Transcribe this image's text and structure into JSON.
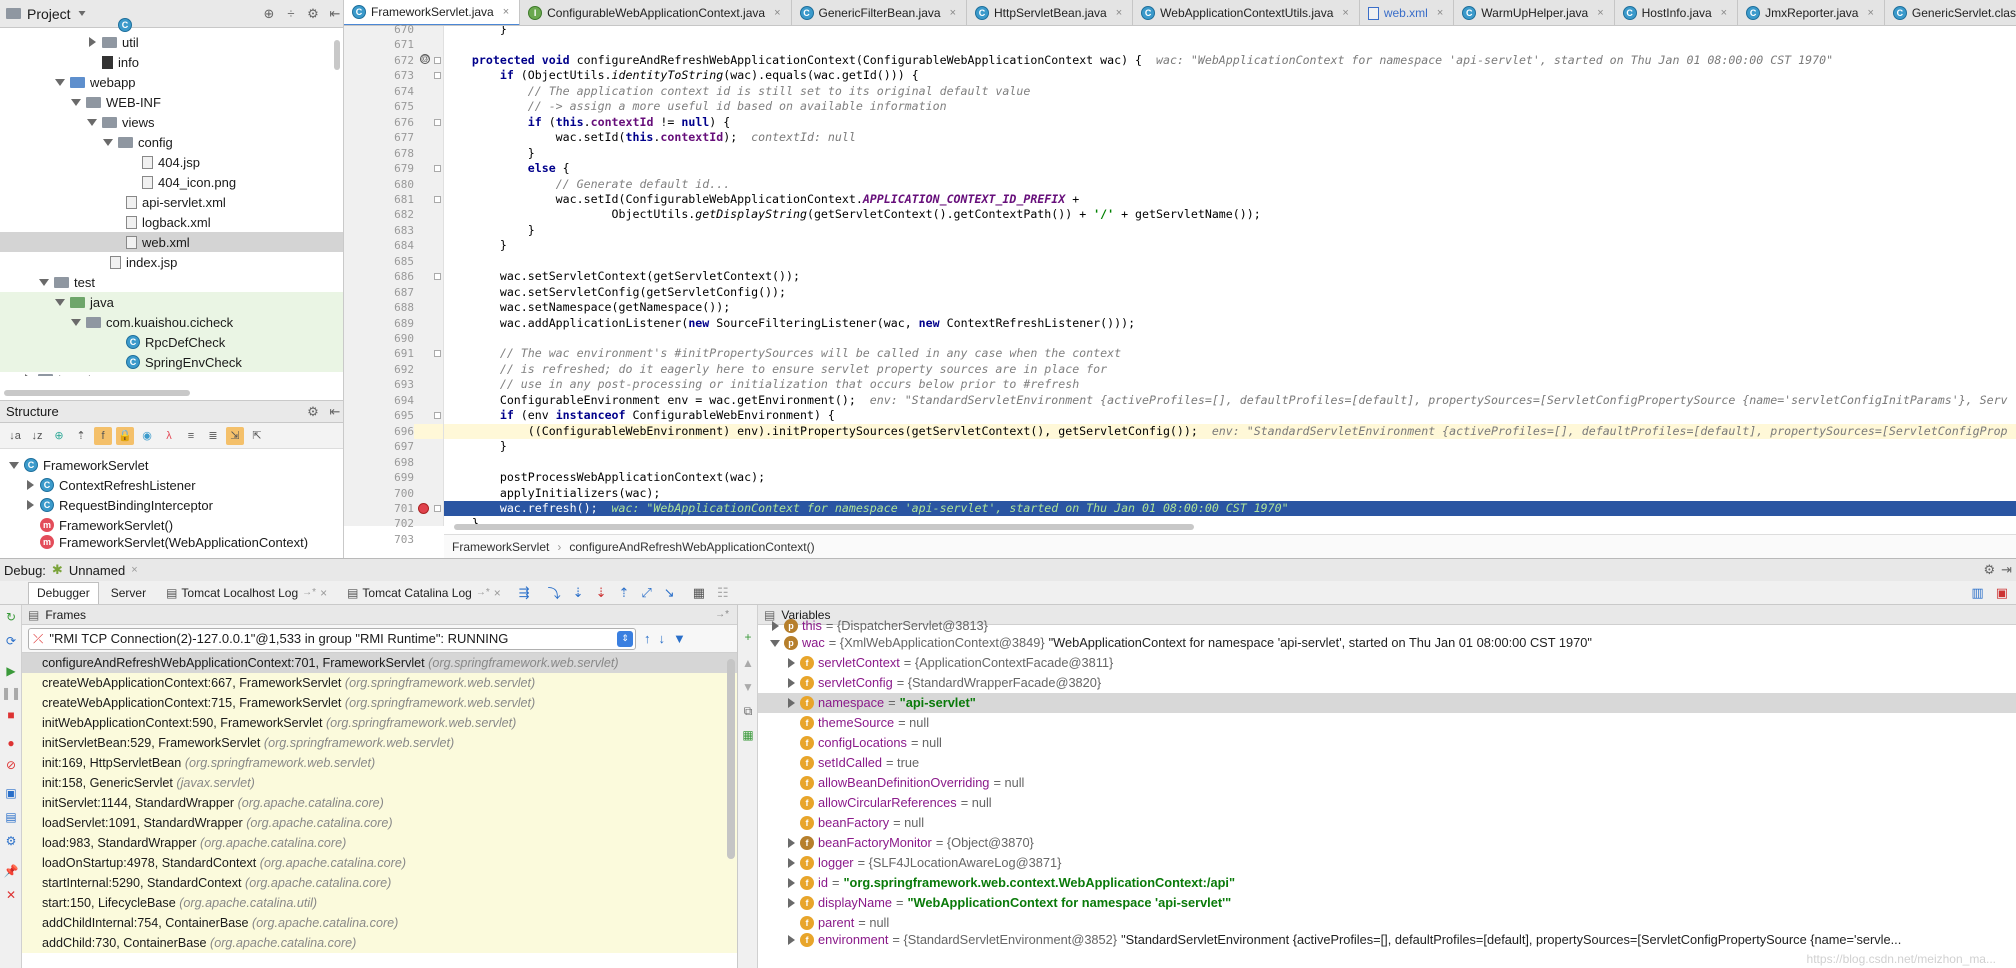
{
  "project": {
    "title": "Project",
    "tree": [
      {
        "label": "",
        "indent": 98,
        "icon": "class",
        "arrow": "none",
        "cut": true
      },
      {
        "label": "util",
        "indent": 82,
        "icon": "folder",
        "arrow": "right"
      },
      {
        "label": "info",
        "indent": 82,
        "icon": "filedark",
        "arrow": "none"
      },
      {
        "label": "webapp",
        "indent": 50,
        "icon": "folder-blue",
        "arrow": "down"
      },
      {
        "label": "WEB-INF",
        "indent": 66,
        "icon": "folder",
        "arrow": "down"
      },
      {
        "label": "views",
        "indent": 82,
        "icon": "folder",
        "arrow": "down"
      },
      {
        "label": "config",
        "indent": 98,
        "icon": "folder",
        "arrow": "down"
      },
      {
        "label": "404.jsp",
        "indent": 122,
        "icon": "file",
        "arrow": "none"
      },
      {
        "label": "404_icon.png",
        "indent": 122,
        "icon": "file",
        "arrow": "none"
      },
      {
        "label": "api-servlet.xml",
        "indent": 106,
        "icon": "file",
        "arrow": "none"
      },
      {
        "label": "logback.xml",
        "indent": 106,
        "icon": "file",
        "arrow": "none"
      },
      {
        "label": "web.xml",
        "indent": 106,
        "icon": "file",
        "arrow": "none",
        "selected": true
      },
      {
        "label": "index.jsp",
        "indent": 90,
        "icon": "file",
        "arrow": "none"
      },
      {
        "label": "test",
        "indent": 34,
        "icon": "folder",
        "arrow": "down"
      },
      {
        "label": "java",
        "indent": 50,
        "icon": "folder-green",
        "arrow": "down",
        "green": true
      },
      {
        "label": "com.kuaishou.cicheck",
        "indent": 66,
        "icon": "folder",
        "arrow": "down",
        "green": true
      },
      {
        "label": "RpcDefCheck",
        "indent": 106,
        "icon": "class",
        "arrow": "none",
        "green": true
      },
      {
        "label": "SpringEnvCheck",
        "indent": 106,
        "icon": "class",
        "arrow": "none",
        "green": true
      },
      {
        "label": "target",
        "indent": 18,
        "icon": "folder",
        "arrow": "right",
        "cut": true
      }
    ]
  },
  "structure": {
    "title": "Structure",
    "tree": [
      {
        "label": "FrameworkServlet",
        "indent": 4,
        "icon": "class",
        "arrow": "down"
      },
      {
        "label": "ContextRefreshListener",
        "indent": 20,
        "icon": "class",
        "arrow": "right"
      },
      {
        "label": "RequestBindingInterceptor",
        "indent": 20,
        "icon": "class",
        "arrow": "right"
      },
      {
        "label": "FrameworkServlet()",
        "indent": 20,
        "icon": "method",
        "arrow": "none"
      },
      {
        "label": "FrameworkServlet(WebApplicationContext)",
        "indent": 20,
        "icon": "method",
        "arrow": "none",
        "cut": true
      }
    ]
  },
  "editor": {
    "tabs": [
      {
        "label": "FrameworkServlet.java",
        "icon": "class",
        "active": true
      },
      {
        "label": "ConfigurableWebApplicationContext.java",
        "icon": "interface"
      },
      {
        "label": "GenericFilterBean.java",
        "icon": "class"
      },
      {
        "label": "HttpServletBean.java",
        "icon": "class"
      },
      {
        "label": "WebApplicationContextUtils.java",
        "icon": "class"
      },
      {
        "label": "web.xml",
        "icon": "xml",
        "blue": true
      },
      {
        "label": "WarmUpHelper.java",
        "icon": "class"
      },
      {
        "label": "HostInfo.java",
        "icon": "class"
      },
      {
        "label": "JmxReporter.java",
        "icon": "class"
      },
      {
        "label": "GenericServlet.class",
        "icon": "class"
      }
    ],
    "lines": [
      {
        "n": "670",
        "h": "        }"
      },
      {
        "n": "671",
        "h": ""
      },
      {
        "n": "672",
        "h": "    <span class=\"kw\">protected void</span> configureAndRefreshWebApplicationContext(ConfigurableWebApplicationContext wac) {  <span class=\"hint\">wac: \"WebApplicationContext for namespace 'api-servlet', started on Thu Jan 01 08:00:00 CST 1970\"</span>"
      },
      {
        "n": "673",
        "h": "        <span class=\"kw\">if</span> (ObjectUtils.<span class=\"it\">identityToString</span>(wac).equals(wac.getId())) {"
      },
      {
        "n": "674",
        "h": "            <span class=\"cm\">// The application context id is still set to its original default value</span>"
      },
      {
        "n": "675",
        "h": "            <span class=\"cm\">// -&gt; assign a more useful id based on available information</span>"
      },
      {
        "n": "676",
        "h": "            <span class=\"kw\">if</span> (<span class=\"kw\">this</span>.<span class=\"fd\">contextId</span> != <span class=\"kw\">null</span>) {"
      },
      {
        "n": "677",
        "h": "                wac.setId(<span class=\"kw\">this</span>.<span class=\"fd\">contextId</span>);  <span class=\"hint\">contextId: null</span>"
      },
      {
        "n": "678",
        "h": "            }"
      },
      {
        "n": "679",
        "h": "            <span class=\"kw\">else</span> {"
      },
      {
        "n": "680",
        "h": "                <span class=\"cm\">// Generate default id...</span>"
      },
      {
        "n": "681",
        "h": "                wac.setId(ConfigurableWebApplicationContext.<span class=\"cn\">APPLICATION_CONTEXT_ID_PREFIX</span> +"
      },
      {
        "n": "682",
        "h": "                        ObjectUtils.<span class=\"it\">getDisplayString</span>(getServletContext().getContextPath()) + <span class=\"st\">'/'</span> + getServletName());"
      },
      {
        "n": "683",
        "h": "            }"
      },
      {
        "n": "684",
        "h": "        }"
      },
      {
        "n": "685",
        "h": ""
      },
      {
        "n": "686",
        "h": "        wac.setServletContext(getServletContext());"
      },
      {
        "n": "687",
        "h": "        wac.setServletConfig(getServletConfig());"
      },
      {
        "n": "688",
        "h": "        wac.setNamespace(getNamespace());"
      },
      {
        "n": "689",
        "h": "        wac.addApplicationListener(<span class=\"kw\">new</span> SourceFilteringListener(wac, <span class=\"kw\">new</span> ContextRefreshListener()));"
      },
      {
        "n": "690",
        "h": ""
      },
      {
        "n": "691",
        "h": "        <span class=\"cm\">// The wac environment's #initPropertySources will be called in any case when the context</span>"
      },
      {
        "n": "692",
        "h": "        <span class=\"cm\">// is refreshed; do it eagerly here to ensure servlet property sources are in place for</span>"
      },
      {
        "n": "693",
        "h": "        <span class=\"cm\">// use in any post-processing or initialization that occurs below prior to #refresh</span>"
      },
      {
        "n": "694",
        "h": "        ConfigurableEnvironment env = wac.getEnvironment();  <span class=\"hint\">env: \"StandardServletEnvironment {activeProfiles=[], defaultProfiles=[default], propertySources=[ServletConfigPropertySource {name='servletConfigInitParams'}, Serv</span>"
      },
      {
        "n": "695",
        "h": "        <span class=\"kw\">if</span> (env <span class=\"kw\">instanceof</span> ConfigurableWebEnvironment) {"
      },
      {
        "n": "696",
        "h": "            ((ConfigurableWebEnvironment) env).initPropertySources(getServletContext(), getServletConfig());  <span class=\"hint\">env: \"StandardServletEnvironment {activeProfiles=[], defaultProfiles=[default], propertySources=[ServletConfigProp</span>",
        "cur": true
      },
      {
        "n": "697",
        "h": "        }"
      },
      {
        "n": "698",
        "h": ""
      },
      {
        "n": "699",
        "h": "        postProcessWebApplicationContext(wac);"
      },
      {
        "n": "700",
        "h": "        applyInitializers(wac);"
      },
      {
        "n": "701",
        "h": "        wac.refresh();  <span class=\"hint\">wac: \"WebApplicationContext for namespace 'api-servlet', started on Thu Jan 01 08:00:00 CST 1970\"</span>",
        "hl": true
      },
      {
        "n": "702",
        "h": "    }"
      },
      {
        "n": "703",
        "h": ""
      }
    ],
    "breadcrumb": [
      "FrameworkServlet",
      "configureAndRefreshWebApplicationContext()"
    ]
  },
  "debug": {
    "label": "Debug:",
    "session": "Unnamed",
    "tabs": [
      "Debugger",
      "Server",
      "Tomcat Localhost Log",
      "Tomcat Catalina Log"
    ],
    "frames_title": "Frames",
    "variables_title": "Variables",
    "thread": "\"RMI TCP Connection(2)-127.0.0.1\"@1,533 in group \"RMI Runtime\": RUNNING",
    "frames": [
      {
        "m": "configureAndRefreshWebApplicationContext:701, FrameworkServlet",
        "p": "(org.springframework.web.servlet)",
        "sel": true
      },
      {
        "m": "createWebApplicationContext:667, FrameworkServlet",
        "p": "(org.springframework.web.servlet)"
      },
      {
        "m": "createWebApplicationContext:715, FrameworkServlet",
        "p": "(org.springframework.web.servlet)"
      },
      {
        "m": "initWebApplicationContext:590, FrameworkServlet",
        "p": "(org.springframework.web.servlet)"
      },
      {
        "m": "initServletBean:529, FrameworkServlet",
        "p": "(org.springframework.web.servlet)"
      },
      {
        "m": "init:169, HttpServletBean",
        "p": "(org.springframework.web.servlet)"
      },
      {
        "m": "init:158, GenericServlet",
        "p": "(javax.servlet)"
      },
      {
        "m": "initServlet:1144, StandardWrapper",
        "p": "(org.apache.catalina.core)"
      },
      {
        "m": "loadServlet:1091, StandardWrapper",
        "p": "(org.apache.catalina.core)"
      },
      {
        "m": "load:983, StandardWrapper",
        "p": "(org.apache.catalina.core)"
      },
      {
        "m": "loadOnStartup:4978, StandardContext",
        "p": "(org.apache.catalina.core)"
      },
      {
        "m": "startInternal:5290, StandardContext",
        "p": "(org.apache.catalina.core)"
      },
      {
        "m": "start:150, LifecycleBase",
        "p": "(org.apache.catalina.util)"
      },
      {
        "m": "addChildInternal:754, ContainerBase",
        "p": "(org.apache.catalina.core)"
      },
      {
        "m": "addChild:730, ContainerBase",
        "p": "(org.apache.catalina.core)"
      }
    ],
    "variables": [
      {
        "indent": 0,
        "arrow": "right",
        "icon": "p",
        "name": "this",
        "val": " = {DispatcherServlet@3813}",
        "cut": true
      },
      {
        "indent": 0,
        "arrow": "down",
        "icon": "p",
        "name": "wac",
        "val": " = {XmlWebApplicationContext@3849}",
        "tail": " \"WebApplicationContext for namespace 'api-servlet', started on Thu Jan 01 08:00:00 CST 1970\""
      },
      {
        "indent": 1,
        "arrow": "right",
        "icon": "f",
        "name": "servletContext",
        "val": " = {ApplicationContextFacade@3811}"
      },
      {
        "indent": 1,
        "arrow": "right",
        "icon": "f",
        "name": "servletConfig",
        "val": " = {StandardWrapperFacade@3820}"
      },
      {
        "indent": 1,
        "arrow": "right",
        "icon": "f",
        "name": "namespace",
        "val": " = ",
        "str": "\"api-servlet\"",
        "sel": true
      },
      {
        "indent": 1,
        "arrow": "none",
        "icon": "f",
        "name": "themeSource",
        "val": " = null"
      },
      {
        "indent": 1,
        "arrow": "none",
        "icon": "f",
        "name": "configLocations",
        "val": " = null"
      },
      {
        "indent": 1,
        "arrow": "none",
        "icon": "f",
        "name": "setIdCalled",
        "val": " = true"
      },
      {
        "indent": 1,
        "arrow": "none",
        "icon": "f",
        "name": "allowBeanDefinitionOverriding",
        "val": " = null"
      },
      {
        "indent": 1,
        "arrow": "none",
        "icon": "f",
        "name": "allowCircularReferences",
        "val": " = null"
      },
      {
        "indent": 1,
        "arrow": "none",
        "icon": "f",
        "name": "beanFactory",
        "val": " = null"
      },
      {
        "indent": 1,
        "arrow": "right",
        "icon": "f",
        "name": "beanFactoryMonitor",
        "val": " = {Object@3870}"
      },
      {
        "indent": 1,
        "arrow": "right",
        "icon": "f",
        "name": "logger",
        "val": " = {SLF4JLocationAwareLog@3871}"
      },
      {
        "indent": 1,
        "arrow": "right",
        "icon": "f",
        "name": "id",
        "val": " = ",
        "str": "\"org.springframework.web.context.WebApplicationContext:/api\""
      },
      {
        "indent": 1,
        "arrow": "right",
        "icon": "f",
        "name": "displayName",
        "val": " = ",
        "str": "\"WebApplicationContext for namespace 'api-servlet'\""
      },
      {
        "indent": 1,
        "arrow": "none",
        "icon": "f",
        "name": "parent",
        "val": " = null"
      },
      {
        "indent": 1,
        "arrow": "right",
        "icon": "f",
        "name": "environment",
        "val": " = {StandardServletEnvironment@3852}",
        "tail": " \"StandardServletEnvironment {activeProfiles=[], defaultProfiles=[default], propertySources=[ServletConfigPropertySource {name='servle...",
        "cut": true
      }
    ],
    "watermark": "https://blog.csdn.net/meizhon_ma..."
  }
}
